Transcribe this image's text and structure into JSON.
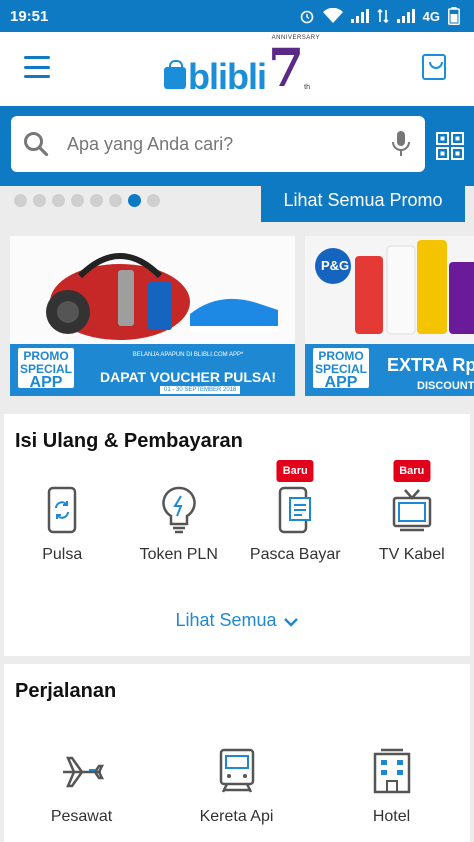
{
  "status_bar": {
    "time": "19:51",
    "network": "4G"
  },
  "header": {
    "logo_text": "blibli",
    "logo_number": "7",
    "anniversary": "ANNIVERSARY",
    "anniversary_suffix": "th"
  },
  "search": {
    "placeholder": "Apa yang Anda cari?"
  },
  "promo": {
    "see_all_label": "Lihat Semua Promo",
    "dots_count": 8,
    "active_dot": 6
  },
  "banners": [
    {
      "badge_line1": "PROMO",
      "badge_line2": "SPECIAL",
      "badge_line3": "APP",
      "small_text": "BELANJA APAPUN DI BLIBLI.COM APP*",
      "main_text": "DAPAT VOUCHER PULSA!",
      "date": "01 - 30 SEPTEMBER 2018"
    },
    {
      "badge_line1": "PROMO",
      "badge_line2": "SPECIAL",
      "badge_line3": "APP",
      "main_text": "EXTRA Rp",
      "sub_text": "DISCOUNT FOR ALL P&",
      "brand": "P&G"
    }
  ],
  "payment": {
    "title": "Isi Ulang & Pembayaran",
    "items": [
      {
        "label": "Pulsa",
        "icon": "phone-refresh-icon",
        "badge": ""
      },
      {
        "label": "Token PLN",
        "icon": "lightbulb-icon",
        "badge": ""
      },
      {
        "label": "Pasca Bayar",
        "icon": "phone-bill-icon",
        "badge": "Baru"
      },
      {
        "label": "TV Kabel",
        "icon": "tv-icon",
        "badge": "Baru"
      }
    ],
    "see_all_label": "Lihat Semua"
  },
  "travel": {
    "title": "Perjalanan",
    "items": [
      {
        "label": "Pesawat",
        "icon": "airplane-icon"
      },
      {
        "label": "Kereta Api",
        "icon": "train-icon"
      },
      {
        "label": "Hotel",
        "icon": "hotel-icon"
      }
    ]
  },
  "colors": {
    "primary": "#0f7ac4",
    "accent_blue": "#1e89d2",
    "badge_red": "#e2001a",
    "logo_purple": "#5a2a86"
  }
}
